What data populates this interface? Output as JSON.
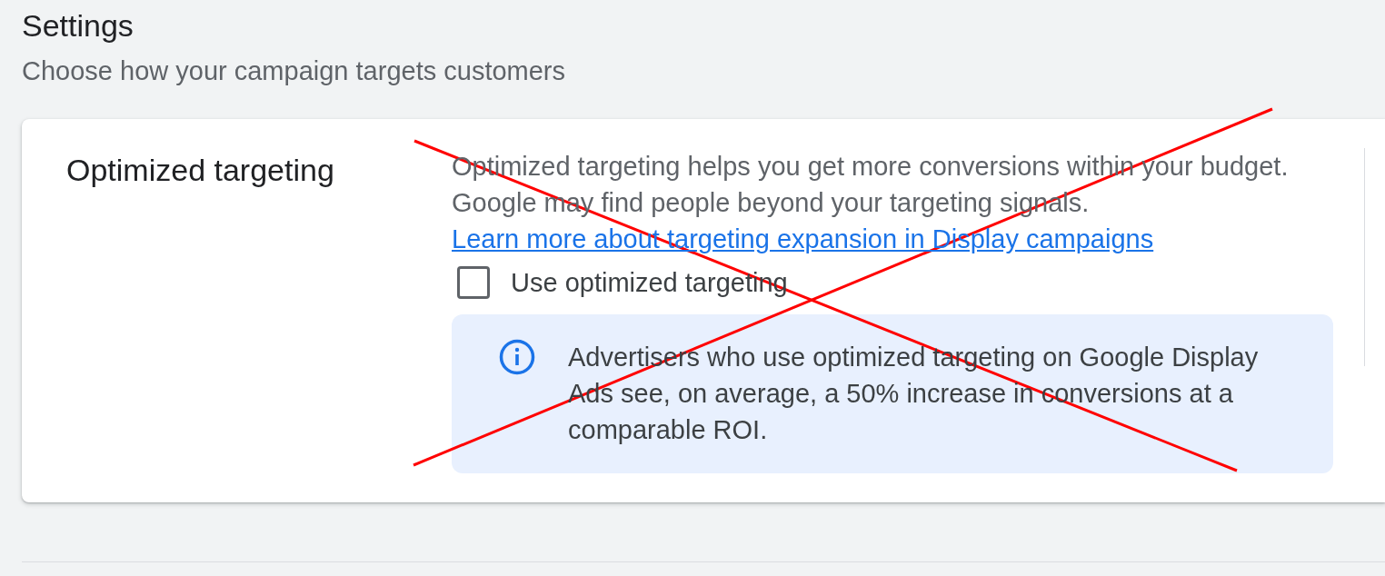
{
  "page": {
    "title": "Settings",
    "subtitle": "Choose how your campaign targets customers"
  },
  "card": {
    "title": "Optimized targeting",
    "description": {
      "text": "Optimized targeting helps you get more conversions within your budget. Google may find people beyond your targeting signals.",
      "link": "Learn more about targeting expansion in Display campaigns"
    },
    "checkbox": {
      "label": "Use optimized targeting",
      "checked": false
    },
    "info": {
      "text": "Advertisers who use optimized targeting on Google Display Ads see, on average, a 50% increase in conversions at a comparable ROI."
    }
  },
  "annotation": {
    "kind": "cross"
  }
}
